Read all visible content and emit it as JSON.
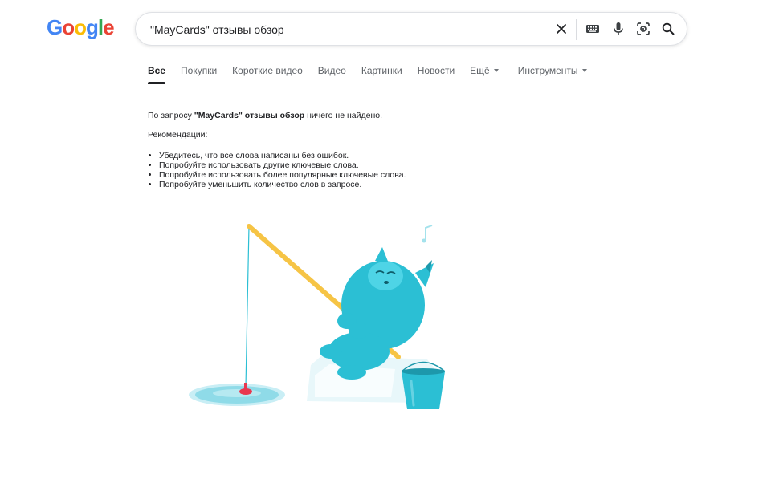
{
  "logo": {
    "letters": [
      "G",
      "o",
      "o",
      "g",
      "l",
      "e"
    ],
    "colors": [
      "#4285F4",
      "#EA4335",
      "#FBBC05",
      "#4285F4",
      "#34A853",
      "#EA4335"
    ]
  },
  "search": {
    "query": "\"MayCards\" отзывы обзор"
  },
  "search_icons": [
    "close-icon",
    "keyboard-icon",
    "microphone-icon",
    "lens-icon",
    "search-icon"
  ],
  "tabs": {
    "all": "Все",
    "shopping": "Покупки",
    "short_videos": "Короткие видео",
    "videos": "Видео",
    "images": "Картинки",
    "news": "Новости",
    "more": "Ещё",
    "tools": "Инструменты"
  },
  "results": {
    "no_results_prefix": "По запросу ",
    "query_bold": "\"MayCards\" отзывы обзор",
    "no_results_suffix": " ничего не найдено.",
    "recommendations_title": "Рекомендации:",
    "tips": [
      "Убедитесь, что все слова написаны без ошибок.",
      "Попробуйте использовать другие ключевые слова.",
      "Попробуйте использовать более популярные ключевые слова.",
      "Попробуйте уменьшить количество слов в запросе."
    ]
  },
  "colors": {
    "accent": "#202124",
    "muted": "#5f6368",
    "monster": "#2bbfd4",
    "rod": "#f6c445"
  }
}
